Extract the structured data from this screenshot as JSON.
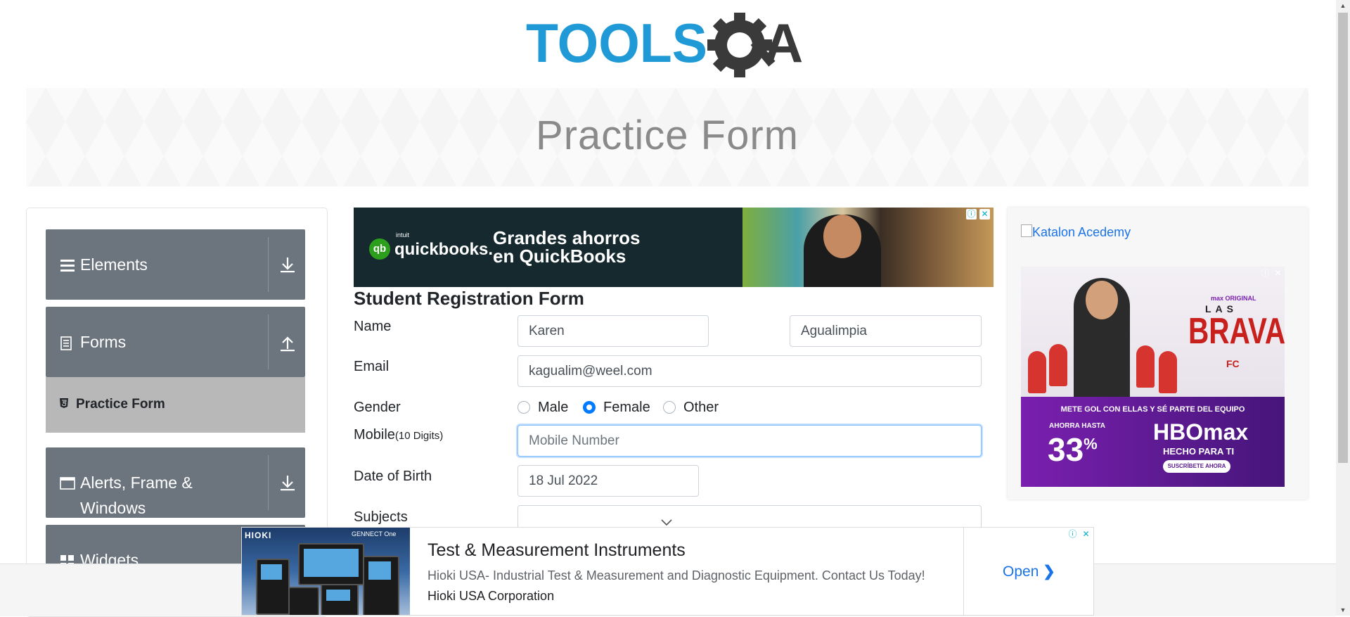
{
  "header": {
    "logo_alt": "TOOLSQA",
    "page_title": "Practice Form"
  },
  "sidebar": {
    "groups": [
      {
        "label": "Elements",
        "icon": "hamburger-icon",
        "state": "collapsed"
      },
      {
        "label": "Forms",
        "icon": "document-icon",
        "state": "expanded"
      },
      {
        "label": "Alerts, Frame & Windows",
        "icon": "window-icon",
        "state": "collapsed"
      },
      {
        "label": "Widgets",
        "icon": "widgets-icon",
        "state": "collapsed"
      }
    ],
    "active_item": {
      "label": "Practice Form",
      "icon": "html5-icon"
    }
  },
  "ads": {
    "top": {
      "brand_small": "intuit",
      "brand": "quickbooks.",
      "logo": "qb",
      "text_line1": "Grandes ahorros",
      "text_line2": "en QuickBooks"
    },
    "right": {
      "link_text": "Katalon Acedemy",
      "max_original": "max ORIGINAL",
      "show_small": "LAS",
      "show_title": "BRAVAS",
      "show_suffix": "FC",
      "tagline": "METE GOL CON ELLAS Y SÉ PARTE DEL EQUIPO",
      "ahorra": "AHORRA HASTA",
      "percent": "33",
      "percent_sign": "%",
      "brand": "HBOmax",
      "hecho": "HECHO PARA TI",
      "cta": "SUSCRÍBETE AHORA"
    },
    "bottom": {
      "brand": "HIOKI",
      "genneet": "GENNECT One",
      "headline": "Test & Measurement Instruments",
      "description": "Hioki USA- Industrial Test & Measurement and Diagnostic Equipment. Contact Us Today!",
      "company": "Hioki USA Corporation",
      "cta": "Open"
    }
  },
  "form": {
    "title": "Student Registration Form",
    "name_label": "Name",
    "first_name": "Karen",
    "last_name": "Agualimpia",
    "email_label": "Email",
    "email": "kagualim@weel.com",
    "gender_label": "Gender",
    "gender_options": [
      "Male",
      "Female",
      "Other"
    ],
    "gender_selected": "Female",
    "mobile_label": "Mobile",
    "mobile_hint": "(10 Digits)",
    "mobile_placeholder": "Mobile Number",
    "dob_label": "Date of Birth",
    "dob": "18 Jul 2022",
    "subjects_label": "Subjects"
  },
  "colors": {
    "accent": "#007bff",
    "sidebar_group": "#6c757d",
    "active_item": "#b8b8b8",
    "logo_blue": "#1f9ad6",
    "logo_dark": "#3a3a3a"
  }
}
